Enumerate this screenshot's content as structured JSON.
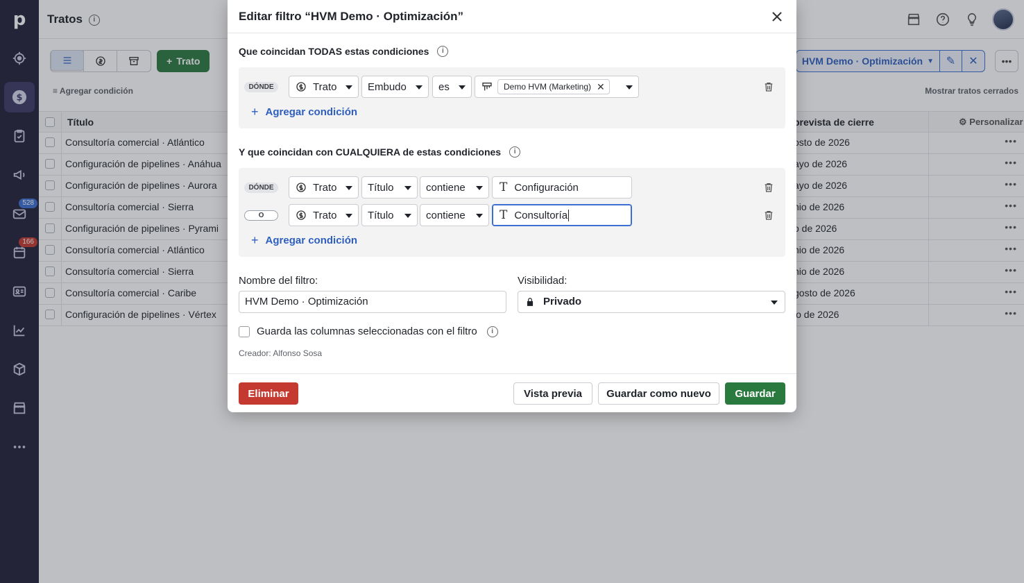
{
  "sidebar": {
    "logo": "p",
    "badges": {
      "mail": "528",
      "calendar": "166"
    },
    "badge_colors": {
      "mail": "#3b6fd1",
      "calendar": "#c43a30"
    },
    "items": [
      {
        "name": "target-icon"
      },
      {
        "name": "deals-icon",
        "active": true
      },
      {
        "name": "tasks-icon"
      },
      {
        "name": "campaigns-icon"
      },
      {
        "name": "mail-icon"
      },
      {
        "name": "calendar-icon"
      },
      {
        "name": "contacts-icon"
      },
      {
        "name": "insights-icon"
      },
      {
        "name": "products-icon"
      },
      {
        "name": "marketplace-icon"
      },
      {
        "name": "more-icon"
      }
    ]
  },
  "header": {
    "title": "Tratos"
  },
  "toolbar": {
    "add_deal_label": "Trato",
    "filter_label": "HVM Demo · Optimización",
    "add_condition_label": "Agregar condición",
    "show_closed_label": "Mostrar tratos cerrados"
  },
  "table": {
    "col_title": "Título",
    "col_close": "prevista de cierre",
    "customize_label": "Personalizar",
    "rows": [
      {
        "title": "Consultoría comercial · Atlántico",
        "close": "osto de 2026"
      },
      {
        "title": "Configuración de pipelines · Anáhua",
        "close": "ayo de 2026"
      },
      {
        "title": "Configuración de pipelines · Aurora",
        "close": "ayo de 2026"
      },
      {
        "title": "Consultoría comercial · Sierra",
        "close": "nio de 2026"
      },
      {
        "title": "Configuración de pipelines · Pyrami",
        "close": "o de 2026"
      },
      {
        "title": "Consultoría comercial · Atlántico",
        "close": "nio de 2026"
      },
      {
        "title": "Consultoría comercial · Sierra",
        "close": "nio de 2026"
      },
      {
        "title": "Consultoría comercial · Caribe",
        "close": "gosto de 2026"
      },
      {
        "title": "Configuración de pipelines · Vértex",
        "close": "io de 2026"
      }
    ]
  },
  "modal": {
    "title": "Editar filtro “HVM Demo · Optimización”",
    "all_section_title": "Que coincidan TODAS estas condiciones",
    "any_section_title": "Y que coincidan con CUALQUIERA de estas condiciones",
    "where_tag": "DÓNDE",
    "or_tag": "O",
    "add_condition": "Agregar condición",
    "all_conditions": [
      {
        "entity": "Trato",
        "field": "Embudo",
        "operator": "es",
        "value_chip": "Demo HVM (Marketing)"
      }
    ],
    "any_conditions": [
      {
        "entity": "Trato",
        "field": "Título",
        "operator": "contiene",
        "value": "Configuración"
      },
      {
        "entity": "Trato",
        "field": "Título",
        "operator": "contiene",
        "value": "Consultoría"
      }
    ],
    "filter_name_label": "Nombre del filtro:",
    "filter_name_value": "HVM Demo · Optimización",
    "visibility_label": "Visibilidad:",
    "visibility_value": "Privado",
    "save_columns_label": "Guarda las columnas seleccionadas con el filtro",
    "creator": "Creador: Alfonso Sosa",
    "buttons": {
      "delete": "Eliminar",
      "preview": "Vista previa",
      "save_as_new": "Guardar como nuevo",
      "save": "Guardar"
    }
  },
  "colors": {
    "sidebar_bg": "#22213a",
    "primary_green": "#2a7a3f",
    "danger_red": "#c43a30",
    "link_blue": "#2e5fbf"
  }
}
